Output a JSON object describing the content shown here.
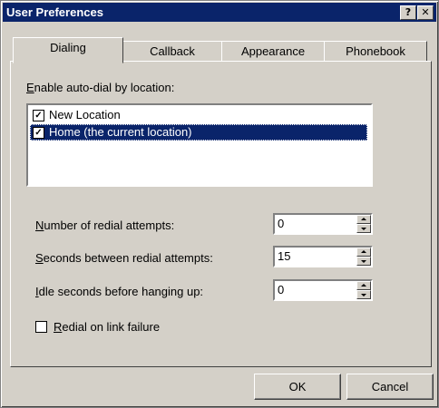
{
  "window": {
    "title": "User Preferences",
    "help_glyph": "?",
    "close_glyph": "✕"
  },
  "tabs": [
    {
      "label": "Dialing",
      "active": true
    },
    {
      "label": "Callback",
      "active": false
    },
    {
      "label": "Appearance",
      "active": false
    },
    {
      "label": "Phonebook",
      "active": false
    }
  ],
  "autodial": {
    "label_hotkey": "E",
    "label_rest": "nable auto-dial by location:",
    "items": [
      {
        "label": "New Location",
        "checked": true,
        "selected": false
      },
      {
        "label": "Home (the current location)",
        "checked": true,
        "selected": true
      }
    ]
  },
  "fields": [
    {
      "hotkey": "N",
      "rest": "umber of redial attempts:",
      "value": "0"
    },
    {
      "hotkey": "S",
      "rest": "econds between redial attempts:",
      "value": "15"
    },
    {
      "hotkey": "I",
      "rest": "dle seconds before hanging up:",
      "value": "0"
    }
  ],
  "redial_checkbox": {
    "hotkey": "R",
    "rest": "edial on link failure",
    "checked": false
  },
  "buttons": {
    "ok": "OK",
    "cancel": "Cancel"
  },
  "check_glyph": "✓"
}
